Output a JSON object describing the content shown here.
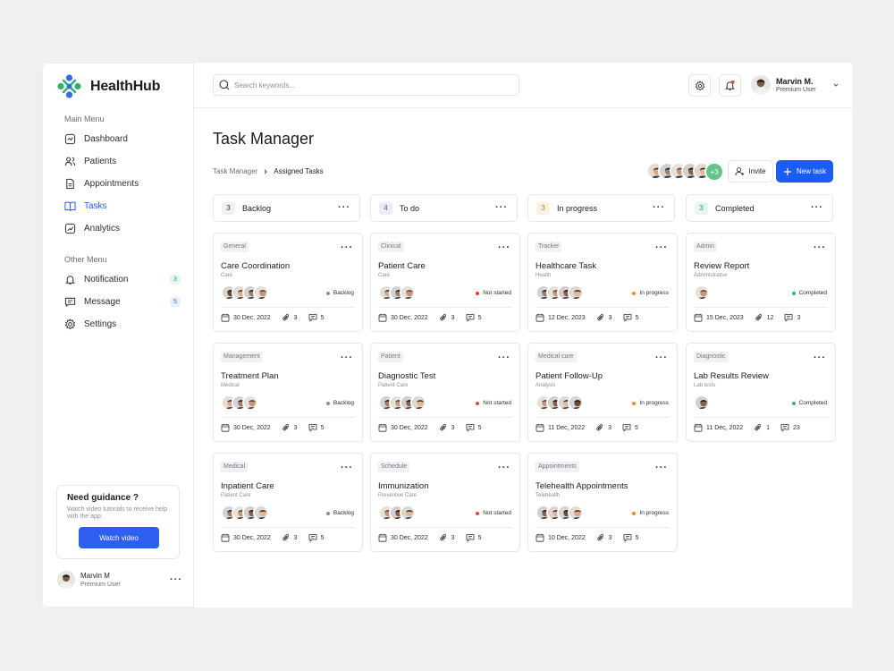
{
  "app": {
    "name": "HealthHub"
  },
  "sidebar": {
    "main_menu_title": "Main Menu",
    "main_items": [
      {
        "label": "Dashboard",
        "icon": "dashboard-icon"
      },
      {
        "label": "Patients",
        "icon": "users-icon"
      },
      {
        "label": "Appointments",
        "icon": "document-icon"
      },
      {
        "label": "Tasks",
        "icon": "book-icon",
        "active": true
      },
      {
        "label": "Analytics",
        "icon": "chart-icon"
      }
    ],
    "other_menu_title": "Other Menu",
    "other_items": [
      {
        "label": "Notification",
        "icon": "bell-icon",
        "count": "3"
      },
      {
        "label": "Message",
        "icon": "message-icon",
        "count": "5"
      },
      {
        "label": "Settings",
        "icon": "gear-icon"
      }
    ],
    "guide": {
      "title": "Need guidance ?",
      "description": "Watch video tutorials to receive help with the app.",
      "button": "Watch video"
    },
    "user": {
      "name": "Marvin M",
      "role": "Premium User"
    }
  },
  "topbar": {
    "search_placeholder": "Search keywords...",
    "user": {
      "name": "Marvin M.",
      "role": "Premium User"
    }
  },
  "page": {
    "title": "Task Manager",
    "breadcrumb": [
      "Task Manager",
      "Assigned Tasks"
    ],
    "more_avatars": "+3",
    "invite_label": "Invite",
    "new_task_label": "New task"
  },
  "colors": {
    "accent": "#1a5cf5",
    "backlog": "#8c8f96",
    "not_started": "#e5483a",
    "in_progress": "#f08a24",
    "completed": "#2fb36b"
  },
  "columns": [
    {
      "name": "Backlog",
      "count": "3",
      "cards": [
        {
          "tag": "General",
          "title": "Care Coordination",
          "subtitle": "Care",
          "avatars": 4,
          "status": "Backlog",
          "date": "30 Dec, 2022",
          "attachments": "3",
          "comments": "5"
        },
        {
          "tag": "Management",
          "title": "Treatment Plan",
          "subtitle": "Medical",
          "avatars": 3,
          "status": "Backlog",
          "date": "30 Dec, 2022",
          "attachments": "3",
          "comments": "5"
        },
        {
          "tag": "Medical",
          "title": "Inpatient Care",
          "subtitle": "Patient Care",
          "avatars": 4,
          "status": "Backlog",
          "date": "30 Dec, 2022",
          "attachments": "3",
          "comments": "5"
        }
      ]
    },
    {
      "name": "To do",
      "count": "4",
      "cards": [
        {
          "tag": "Clinical",
          "title": "Patient Care",
          "subtitle": "Care",
          "avatars": 3,
          "status": "Not started",
          "date": "30 Dec, 2022",
          "attachments": "3",
          "comments": "5"
        },
        {
          "tag": "Patient",
          "title": "Diagnostic Test",
          "subtitle": "Patient Care",
          "avatars": 4,
          "status": "Not started",
          "date": "30 Dec, 2022",
          "attachments": "3",
          "comments": "5"
        },
        {
          "tag": "Schedule",
          "title": "Immunization",
          "subtitle": "Preventive Care",
          "avatars": 3,
          "status": "Not started",
          "date": "30 Dec, 2022",
          "attachments": "3",
          "comments": "5"
        }
      ]
    },
    {
      "name": "In progress",
      "count": "3",
      "cards": [
        {
          "tag": "Tracker",
          "title": "Healthcare Task",
          "subtitle": "Health",
          "avatars": 4,
          "status": "In progress",
          "date": "12 Dec, 2023",
          "attachments": "3",
          "comments": "5"
        },
        {
          "tag": "Medical care",
          "title": "Patient Follow-Up",
          "subtitle": "Analysis",
          "avatars": 4,
          "status": "In progress",
          "date": "11 Dec, 2022",
          "attachments": "3",
          "comments": "5"
        },
        {
          "tag": "Appointments",
          "title": "Telehealth Appointments",
          "subtitle": "Telehealth",
          "avatars": 4,
          "status": "In progress",
          "date": "10 Dec, 2022",
          "attachments": "3",
          "comments": "5"
        }
      ]
    },
    {
      "name": "Completed",
      "count": "3",
      "cards": [
        {
          "tag": "Admin",
          "title": "Review Report",
          "subtitle": "Administrative",
          "avatars": 1,
          "status": "Completed",
          "date": "15 Dec, 2023",
          "attachments": "12",
          "comments": "3"
        },
        {
          "tag": "Diagnostic",
          "title": "Lab Results Review",
          "subtitle": "Lab tests",
          "avatars": 1,
          "status": "Completed",
          "date": "11 Dec, 2022",
          "attachments": "1",
          "comments": "23"
        }
      ]
    }
  ]
}
